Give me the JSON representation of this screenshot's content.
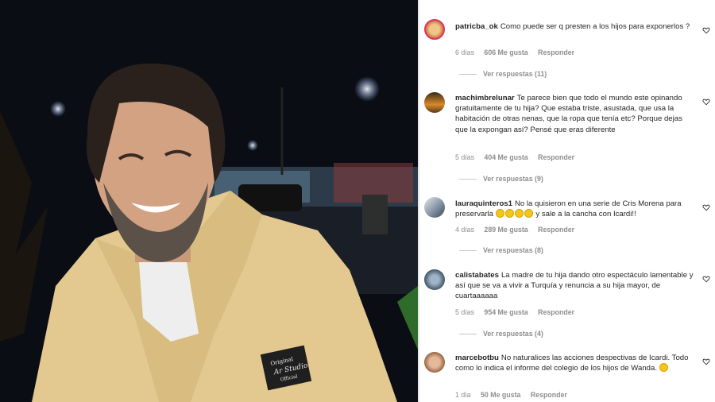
{
  "comments": [
    {
      "username": "patricba_ok",
      "text": "Como puede ser q presten a los hijos para exponerlos ?",
      "time": "6 días",
      "likes": "606 Me gusta",
      "reply": "Responder",
      "view_replies": "Ver respuestas (11)"
    },
    {
      "username": "machimbrelunar",
      "text": "Te parece bien que todo el mundo este opinando gratuitamente de tu hija? Que estaba triste, asustada, que usa la habitación de otras nenas, que la ropa que tenía etc? Porque dejas que la expongan así? Pensé que eras diferente",
      "time": "5 días",
      "likes": "404 Me gusta",
      "reply": "Responder",
      "view_replies": "Ver respuestas (9)"
    },
    {
      "username": "lauraquinteros1",
      "text": "No la quisieron en una serie de Cris Morena para preservarla",
      "text2": "y sale a la cancha con Icardi!!",
      "time": "4 días",
      "likes": "289 Me gusta",
      "reply": "Responder",
      "view_replies": "Ver respuestas (8)"
    },
    {
      "username": "calistabates",
      "text": "La madre de tu hija dando otro espectáculo lamentable y así que se va a vivir a Turquía y renuncia a su hija mayor, de cuartaaaaaa",
      "time": "5 días",
      "likes": "954 Me gusta",
      "reply": "Responder",
      "view_replies": "Ver respuestas (4)"
    },
    {
      "username": "marcebotbu",
      "text": "No naturalices las acciones despectivas de Icardi. Todo como lo indica el informe del colegio de los hijos de Wanda.",
      "time": "1 día",
      "likes": "50 Me gusta",
      "reply": "Responder"
    }
  ],
  "photo": {
    "patch_text_1": "Original",
    "patch_text_2": "Ar Studio",
    "patch_text_3": "Official"
  },
  "colors": {
    "jacket": "#e3c98f",
    "night": "#0b0d14",
    "meta": "#8e8e8e"
  }
}
